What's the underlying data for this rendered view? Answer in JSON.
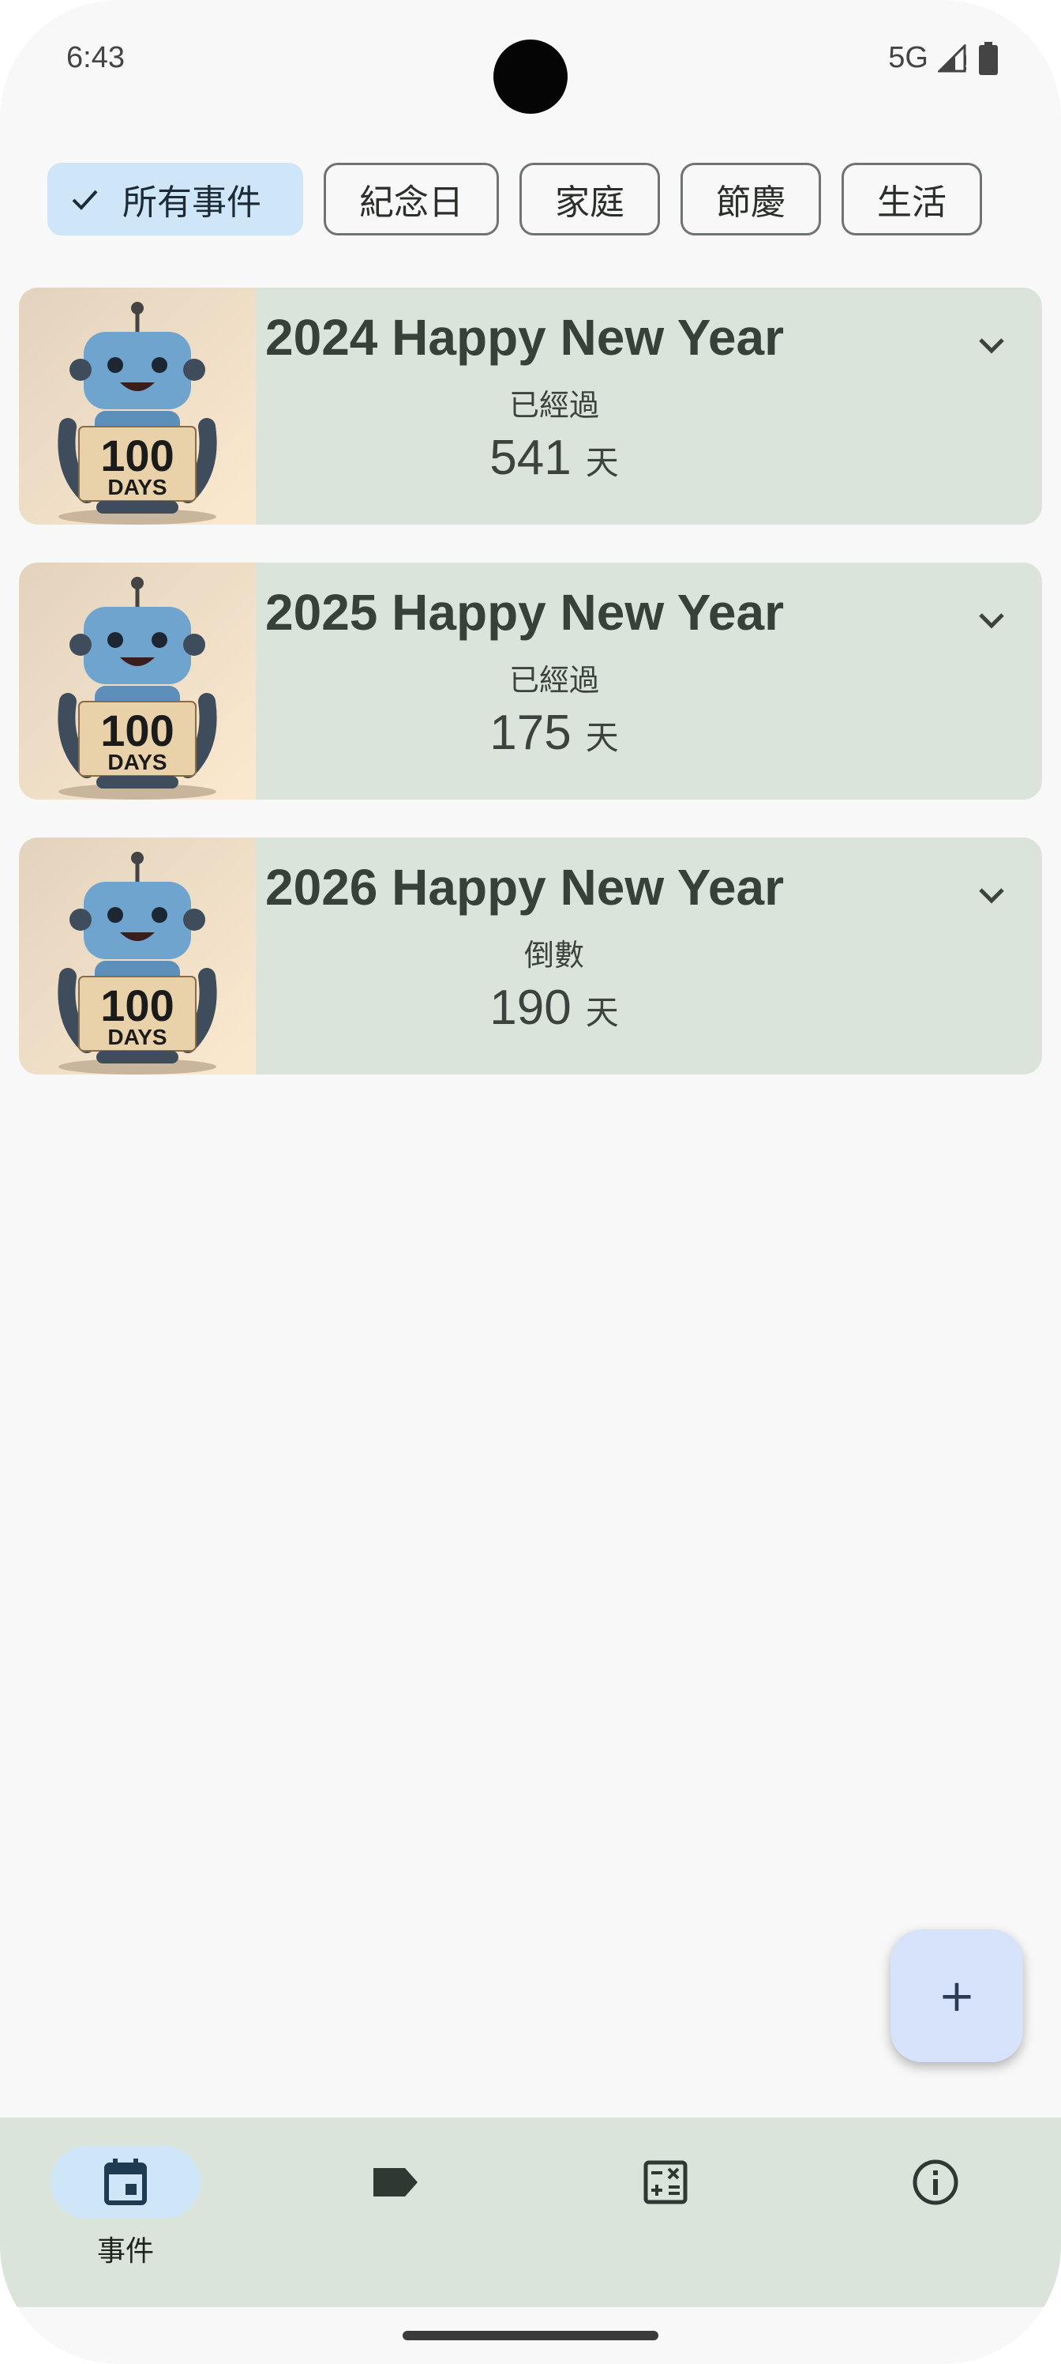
{
  "status_bar": {
    "time": "6:43",
    "network": "5G"
  },
  "chips": [
    {
      "label": "所有事件",
      "selected": true
    },
    {
      "label": "紀念日",
      "selected": false
    },
    {
      "label": "家庭",
      "selected": false
    },
    {
      "label": "節慶",
      "selected": false
    },
    {
      "label": "生活",
      "selected": false
    }
  ],
  "events": [
    {
      "title": "2024 Happy New Year",
      "status": "已經過",
      "count": "541",
      "unit": "天",
      "image_text": "100",
      "image_subtext": "DAYS"
    },
    {
      "title": "2025 Happy New Year",
      "status": "已經過",
      "count": "175",
      "unit": "天",
      "image_text": "100",
      "image_subtext": "DAYS"
    },
    {
      "title": "2026 Happy New Year",
      "status": "倒數",
      "count": "190",
      "unit": "天",
      "image_text": "100",
      "image_subtext": "DAYS"
    }
  ],
  "fab": {
    "icon": "plus-icon",
    "label": "+"
  },
  "bottom_nav": [
    {
      "icon": "calendar-icon",
      "label": "事件",
      "active": true
    },
    {
      "icon": "label-tag-icon",
      "label": "",
      "active": false
    },
    {
      "icon": "calculator-icon",
      "label": "",
      "active": false
    },
    {
      "icon": "info-icon",
      "label": "",
      "active": false
    }
  ],
  "colors": {
    "card": "#dbe4da",
    "selected_chip": "#cfe6f9",
    "fab": "#d7e3fb",
    "nav": "#dbe4da",
    "background": "#f8f8f8"
  }
}
